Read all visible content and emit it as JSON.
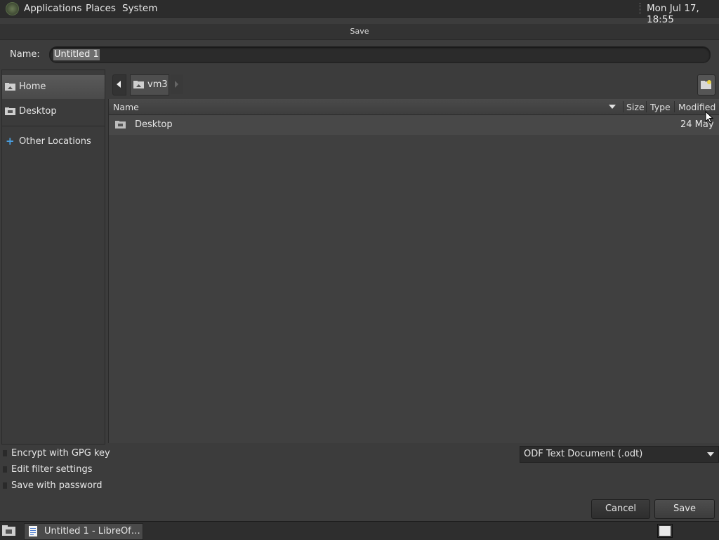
{
  "top_panel": {
    "menus": [
      "Applications",
      "Places",
      "System"
    ],
    "clock": "Mon Jul 17, 18:55"
  },
  "dialog": {
    "title": "Save",
    "name_label": "Name:",
    "name_value": "Untitled 1",
    "sidebar": {
      "items": [
        {
          "label": "Home",
          "icon": "home-folder-icon",
          "selected": true
        },
        {
          "label": "Desktop",
          "icon": "desktop-folder-icon",
          "selected": false
        },
        {
          "label": "Other Locations",
          "icon": "plus-icon",
          "selected": false
        }
      ]
    },
    "path_bar": {
      "crumbs": [
        "vm3"
      ]
    },
    "file_list": {
      "columns": [
        "Name",
        "Size",
        "Type",
        "Modified"
      ],
      "rows": [
        {
          "name": "Desktop",
          "size": "",
          "type": "",
          "modified": "24 May"
        }
      ]
    },
    "options": [
      "Encrypt with GPG key",
      "Edit filter settings",
      "Save with password"
    ],
    "file_type": "ODF Text Document (.odt)",
    "buttons": {
      "cancel": "Cancel",
      "save": "Save"
    }
  },
  "taskbar": {
    "task_label": "Untitled 1 - LibreOf…"
  },
  "colors": {
    "background": "#3c3c3c",
    "panel": "#2c2c2c",
    "selection": "#5a5a5a",
    "text": "#e6e6e6"
  }
}
